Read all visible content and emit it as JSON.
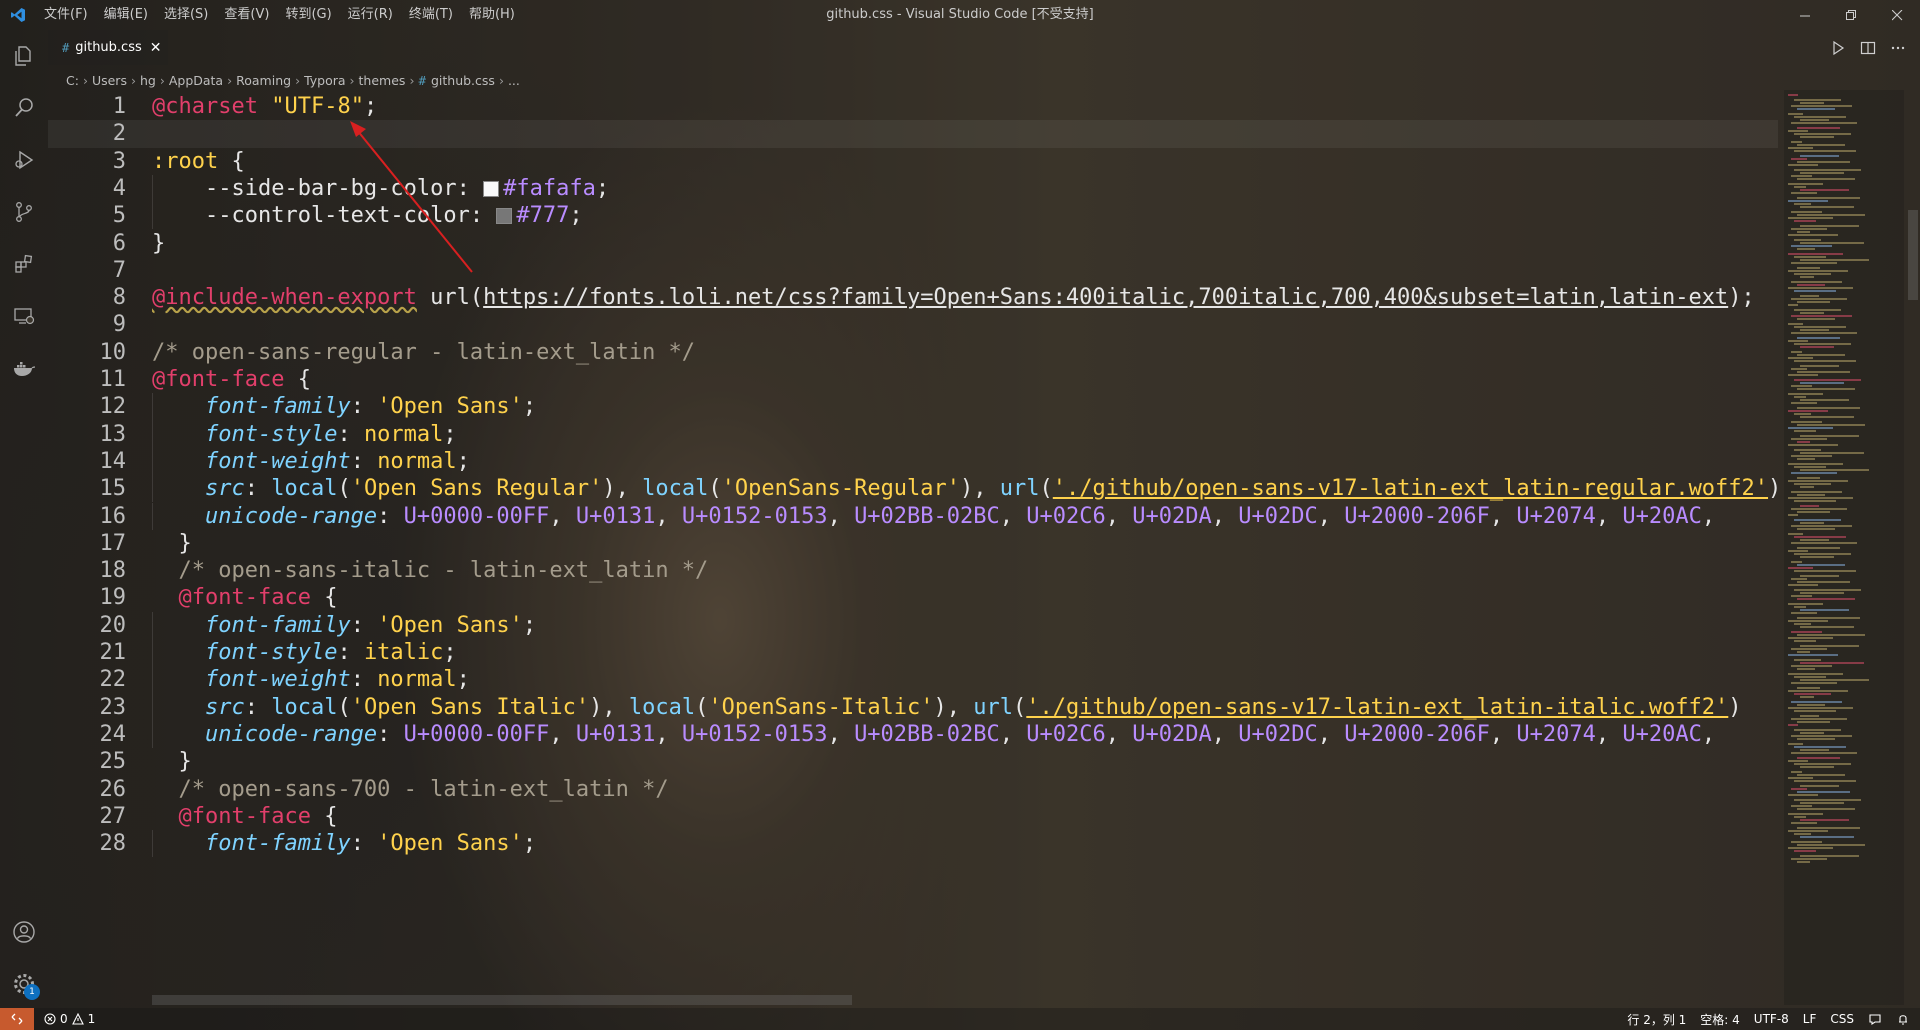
{
  "window": {
    "title": "github.css - Visual Studio Code [不受支持]",
    "menu": [
      "文件(F)",
      "编辑(E)",
      "选择(S)",
      "查看(V)",
      "转到(G)",
      "运行(R)",
      "终端(T)",
      "帮助(H)"
    ]
  },
  "tab": {
    "icon_text": "#",
    "label": "github.css",
    "close": "✕"
  },
  "breadcrumb": {
    "parts": [
      "C:",
      "Users",
      "hg",
      "AppData",
      "Roaming",
      "Typora",
      "themes"
    ],
    "file_hash": "#",
    "file": "github.css",
    "tail": "..."
  },
  "editor": {
    "line_numbers": [
      "1",
      "2",
      "3",
      "4",
      "5",
      "6",
      "7",
      "8",
      "9",
      "10",
      "11",
      "12",
      "13",
      "14",
      "15",
      "16",
      "17",
      "18",
      "19",
      "20",
      "21",
      "22",
      "23",
      "24",
      "25",
      "26",
      "27",
      "28"
    ],
    "lines": [
      {
        "tokens": [
          [
            "at",
            "@charset"
          ],
          [
            "pun",
            " "
          ],
          [
            "str",
            "\"UTF-8\""
          ],
          [
            "pun",
            ";"
          ]
        ]
      },
      {
        "tokens": []
      },
      {
        "tokens": [
          [
            "sel",
            ":root"
          ],
          [
            "pun",
            " {"
          ]
        ]
      },
      {
        "tokens": [
          [
            "prop",
            "    --side-bar-bg-color: "
          ],
          [
            "swatch",
            "#fafafa"
          ],
          [
            "hex",
            "#fafafa"
          ],
          [
            "pun",
            ";"
          ]
        ]
      },
      {
        "tokens": [
          [
            "prop",
            "    --control-text-color: "
          ],
          [
            "swatch",
            "#777777"
          ],
          [
            "hex",
            "#777"
          ],
          [
            "pun",
            ";"
          ]
        ]
      },
      {
        "tokens": [
          [
            "pun",
            "}"
          ]
        ]
      },
      {
        "tokens": []
      },
      {
        "tokens": [
          [
            "inc",
            "@include-when-export"
          ],
          [
            "pun",
            " url("
          ],
          [
            "urlw",
            "https://fonts.loli.net/css?family=Open+Sans:400italic,700italic,700,400&subset=latin,latin-ext"
          ],
          [
            "pun",
            ");"
          ]
        ]
      },
      {
        "tokens": []
      },
      {
        "tokens": [
          [
            "com",
            "/* open-sans-regular - latin-ext_latin */"
          ]
        ]
      },
      {
        "tokens": [
          [
            "at",
            "@font-face"
          ],
          [
            "pun",
            " {"
          ]
        ]
      },
      {
        "tokens": [
          [
            "pun",
            "    "
          ],
          [
            "ital",
            "font-family"
          ],
          [
            "pun",
            ": "
          ],
          [
            "str",
            "'Open Sans'"
          ],
          [
            "pun",
            ";"
          ]
        ]
      },
      {
        "tokens": [
          [
            "pun",
            "    "
          ],
          [
            "ital",
            "font-style"
          ],
          [
            "pun",
            ": "
          ],
          [
            "kw",
            "normal"
          ],
          [
            "pun",
            ";"
          ]
        ]
      },
      {
        "tokens": [
          [
            "pun",
            "    "
          ],
          [
            "ital",
            "font-weight"
          ],
          [
            "pun",
            ": "
          ],
          [
            "kw",
            "normal"
          ],
          [
            "pun",
            ";"
          ]
        ]
      },
      {
        "tokens": [
          [
            "pun",
            "    "
          ],
          [
            "ital",
            "src"
          ],
          [
            "pun",
            ": "
          ],
          [
            "fn",
            "local"
          ],
          [
            "pun",
            "("
          ],
          [
            "str",
            "'Open Sans Regular'"
          ],
          [
            "pun",
            "), "
          ],
          [
            "fn",
            "local"
          ],
          [
            "pun",
            "("
          ],
          [
            "str",
            "'OpenSans-Regular'"
          ],
          [
            "pun",
            "), "
          ],
          [
            "fn",
            "url"
          ],
          [
            "pun",
            "("
          ],
          [
            "url",
            "'./github/open-sans-v17-latin-ext_latin-regular.woff2'"
          ],
          [
            "pun",
            ")"
          ]
        ]
      },
      {
        "tokens": [
          [
            "pun",
            "    "
          ],
          [
            "ital",
            "unicode-range"
          ],
          [
            "pun",
            ": "
          ],
          [
            "uni",
            "U+0000-00FF"
          ],
          [
            "pun",
            ", "
          ],
          [
            "uni",
            "U+0131"
          ],
          [
            "pun",
            ", "
          ],
          [
            "uni",
            "U+0152-0153"
          ],
          [
            "pun",
            ", "
          ],
          [
            "uni",
            "U+02BB-02BC"
          ],
          [
            "pun",
            ", "
          ],
          [
            "uni",
            "U+02C6"
          ],
          [
            "pun",
            ", "
          ],
          [
            "uni",
            "U+02DA"
          ],
          [
            "pun",
            ", "
          ],
          [
            "uni",
            "U+02DC"
          ],
          [
            "pun",
            ", "
          ],
          [
            "uni",
            "U+2000-206F"
          ],
          [
            "pun",
            ", "
          ],
          [
            "uni",
            "U+2074"
          ],
          [
            "pun",
            ", "
          ],
          [
            "uni",
            "U+20AC"
          ],
          [
            "pun",
            ","
          ]
        ]
      },
      {
        "tokens": [
          [
            "pun",
            "  }"
          ]
        ]
      },
      {
        "tokens": [
          [
            "com",
            "  /* open-sans-italic - latin-ext_latin */"
          ]
        ]
      },
      {
        "tokens": [
          [
            "pun",
            "  "
          ],
          [
            "at",
            "@font-face"
          ],
          [
            "pun",
            " {"
          ]
        ]
      },
      {
        "tokens": [
          [
            "pun",
            "    "
          ],
          [
            "ital",
            "font-family"
          ],
          [
            "pun",
            ": "
          ],
          [
            "str",
            "'Open Sans'"
          ],
          [
            "pun",
            ";"
          ]
        ]
      },
      {
        "tokens": [
          [
            "pun",
            "    "
          ],
          [
            "ital",
            "font-style"
          ],
          [
            "pun",
            ": "
          ],
          [
            "kw",
            "italic"
          ],
          [
            "pun",
            ";"
          ]
        ]
      },
      {
        "tokens": [
          [
            "pun",
            "    "
          ],
          [
            "ital",
            "font-weight"
          ],
          [
            "pun",
            ": "
          ],
          [
            "kw",
            "normal"
          ],
          [
            "pun",
            ";"
          ]
        ]
      },
      {
        "tokens": [
          [
            "pun",
            "    "
          ],
          [
            "ital",
            "src"
          ],
          [
            "pun",
            ": "
          ],
          [
            "fn",
            "local"
          ],
          [
            "pun",
            "("
          ],
          [
            "str",
            "'Open Sans Italic'"
          ],
          [
            "pun",
            "), "
          ],
          [
            "fn",
            "local"
          ],
          [
            "pun",
            "("
          ],
          [
            "str",
            "'OpenSans-Italic'"
          ],
          [
            "pun",
            "), "
          ],
          [
            "fn",
            "url"
          ],
          [
            "pun",
            "("
          ],
          [
            "url",
            "'./github/open-sans-v17-latin-ext_latin-italic.woff2'"
          ],
          [
            "pun",
            ")"
          ]
        ]
      },
      {
        "tokens": [
          [
            "pun",
            "    "
          ],
          [
            "ital",
            "unicode-range"
          ],
          [
            "pun",
            ": "
          ],
          [
            "uni",
            "U+0000-00FF"
          ],
          [
            "pun",
            ", "
          ],
          [
            "uni",
            "U+0131"
          ],
          [
            "pun",
            ", "
          ],
          [
            "uni",
            "U+0152-0153"
          ],
          [
            "pun",
            ", "
          ],
          [
            "uni",
            "U+02BB-02BC"
          ],
          [
            "pun",
            ", "
          ],
          [
            "uni",
            "U+02C6"
          ],
          [
            "pun",
            ", "
          ],
          [
            "uni",
            "U+02DA"
          ],
          [
            "pun",
            ", "
          ],
          [
            "uni",
            "U+02DC"
          ],
          [
            "pun",
            ", "
          ],
          [
            "uni",
            "U+2000-206F"
          ],
          [
            "pun",
            ", "
          ],
          [
            "uni",
            "U+2074"
          ],
          [
            "pun",
            ", "
          ],
          [
            "uni",
            "U+20AC"
          ],
          [
            "pun",
            ","
          ]
        ]
      },
      {
        "tokens": [
          [
            "pun",
            "  }"
          ]
        ]
      },
      {
        "tokens": [
          [
            "com",
            "  /* open-sans-700 - latin-ext_latin */"
          ]
        ]
      },
      {
        "tokens": [
          [
            "pun",
            "  "
          ],
          [
            "at",
            "@font-face"
          ],
          [
            "pun",
            " {"
          ]
        ]
      },
      {
        "tokens": [
          [
            "pun",
            "    "
          ],
          [
            "ital",
            "font-family"
          ],
          [
            "pun",
            ": "
          ],
          [
            "str",
            "'Open Sans'"
          ],
          [
            "pun",
            ";"
          ]
        ]
      }
    ]
  },
  "statusbar": {
    "errors": "0",
    "warnings": "1",
    "position": "行 2，列 1",
    "spaces": "空格: 4",
    "encoding": "UTF-8",
    "eol": "LF",
    "language": "CSS"
  },
  "activity_badge": "1",
  "icons": [
    "vscode-logo-icon",
    "explorer-icon",
    "search-icon",
    "run-debug-icon",
    "source-control-icon",
    "extensions-icon",
    "remote-explorer-icon",
    "docker-icon",
    "account-icon",
    "settings-gear-icon",
    "run-icon",
    "split-editor-icon",
    "more-actions-icon",
    "error-icon",
    "warning-icon",
    "remote-icon",
    "feedback-icon",
    "notifications-icon"
  ]
}
